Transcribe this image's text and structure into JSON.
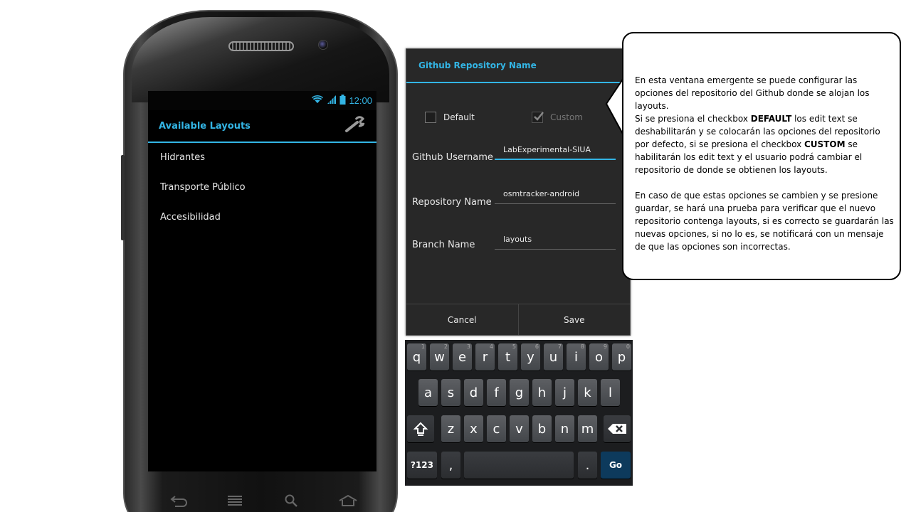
{
  "status_bar": {
    "time": "12:00"
  },
  "app": {
    "title": "Available Layouts",
    "settings_icon": "wrench-icon",
    "layouts": [
      "Hidrantes",
      "Transporte Público",
      "Accesibilidad"
    ]
  },
  "dialog": {
    "title": "Github Repository Name",
    "default_label": "Default",
    "default_checked": false,
    "custom_label": "Custom",
    "custom_checked": true,
    "fields": {
      "username": {
        "label": "Github Username",
        "value": "LabExperimental-SIUA"
      },
      "repository": {
        "label": "Repository Name",
        "value": "osmtracker-android"
      },
      "branch": {
        "label": "Branch Name",
        "value": "layouts"
      }
    },
    "cancel_label": "Cancel",
    "save_label": "Save"
  },
  "keyboard": {
    "row1": [
      "q",
      "w",
      "e",
      "r",
      "t",
      "y",
      "u",
      "i",
      "o",
      "p"
    ],
    "row1_nums": [
      "1",
      "2",
      "3",
      "4",
      "5",
      "6",
      "7",
      "8",
      "9",
      "0"
    ],
    "row2": [
      "a",
      "s",
      "d",
      "f",
      "g",
      "h",
      "j",
      "k",
      "l"
    ],
    "row3": [
      "z",
      "x",
      "c",
      "v",
      "b",
      "n",
      "m"
    ],
    "symbols_label": "?123",
    "comma": ",",
    "period": ".",
    "go_label": "Go"
  },
  "callout": {
    "p1_a": "En esta ventana emergente se puede configurar las opciones del repositorio del Github donde se alojan los layouts.",
    "p1_b": "Si se presiona el checkbox ",
    "p1_default": "DEFAULT",
    "p1_c": " los edit text se deshabilitarán y se colocarán las opciones del repositorio por defecto, si se presiona el checkbox ",
    "p1_custom": "CUSTOM",
    "p1_d": " se habilitarán los edit text y el usuario podrá cambiar el repositorio de donde se obtienen los layouts.",
    "p2": "En caso de que estas opciones se cambien y se presione guardar, se hará una prueba para verificar que el nuevo repositorio contenga layouts, si es correcto se guardarán las nuevas opciones, si no lo es, se notificará con un mensaje de que las opciones son incorrectas."
  },
  "colors": {
    "accent": "#33b5e5",
    "dialog_bg": "#282828",
    "go_key": "#0d3a5c"
  }
}
